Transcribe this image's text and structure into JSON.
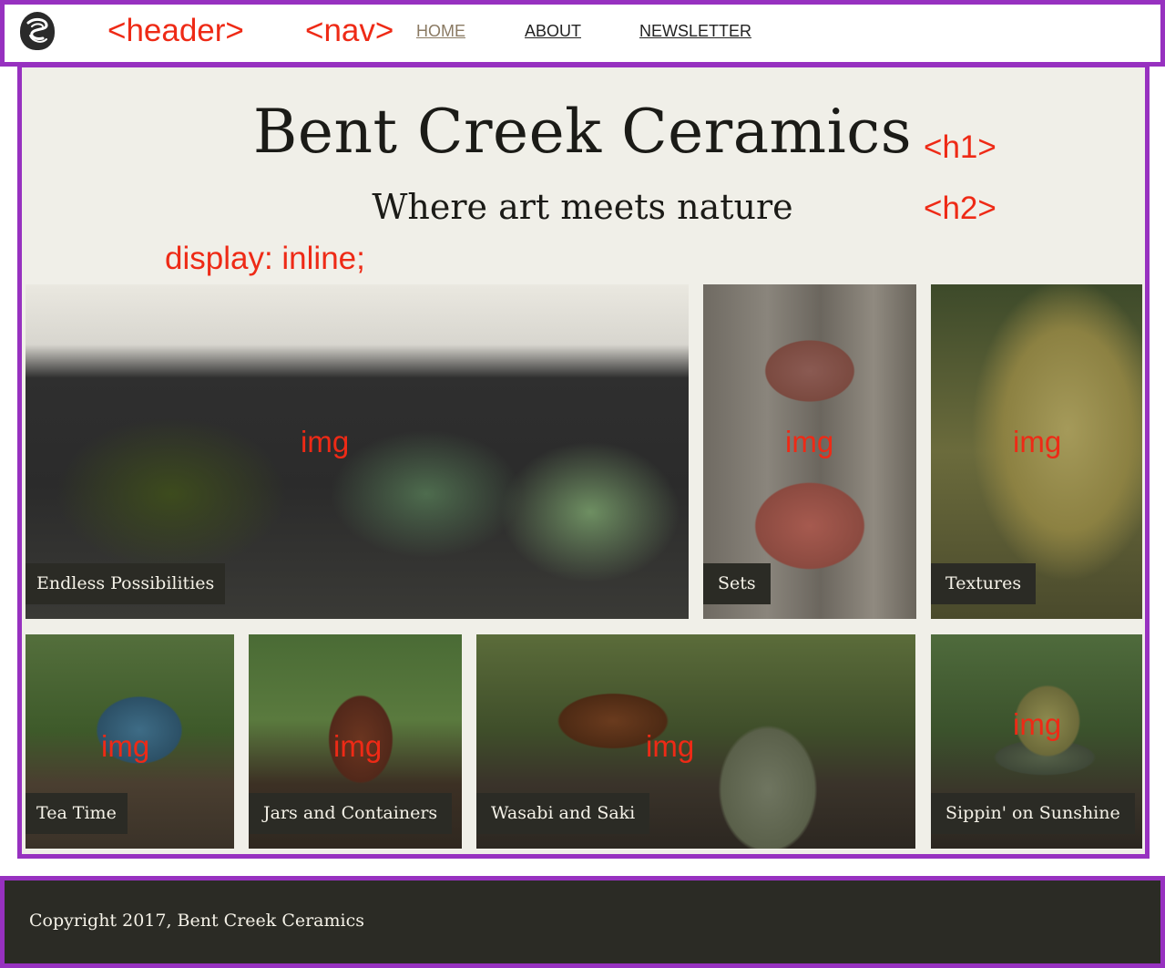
{
  "annotations": {
    "header": "<header>",
    "nav": "<nav>",
    "h1": "<h1>",
    "h2": "<h2>",
    "display": "display: inline;",
    "img": "img"
  },
  "header": {
    "logo_icon": "swirl-logo-icon",
    "nav": [
      {
        "label": "HOME",
        "active": true
      },
      {
        "label": "ABOUT",
        "active": false
      },
      {
        "label": "NEWSLETTER",
        "active": false
      }
    ]
  },
  "main": {
    "title": "Bent Creek Ceramics",
    "subtitle": "Where art meets nature",
    "gallery": [
      {
        "caption": "Endless Possibilities"
      },
      {
        "caption": "Sets"
      },
      {
        "caption": "Textures"
      },
      {
        "caption": "Tea Time"
      },
      {
        "caption": "Jars and Containers"
      },
      {
        "caption": "Wasabi and Saki"
      },
      {
        "caption": "Sippin' on Sunshine"
      }
    ]
  },
  "footer": {
    "copyright": "Copyright 2017, Bent Creek Ceramics"
  },
  "colors": {
    "outline": "#9731c0",
    "annotation": "#ee2a16",
    "main_bg": "#f0efe8",
    "caption_bg": "#2b2b25",
    "footer_bg": "#2b2b25",
    "nav_active": "#8a7a63"
  }
}
